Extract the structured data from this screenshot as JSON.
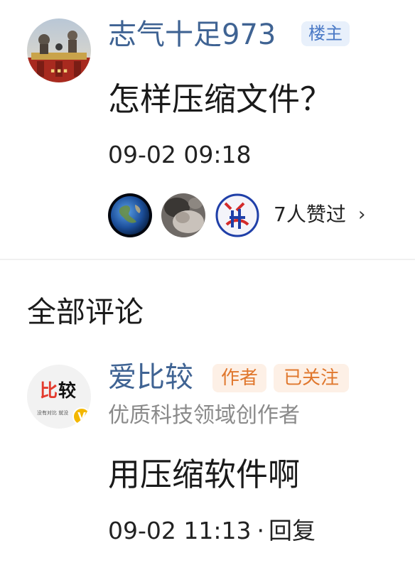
{
  "post": {
    "author": "志气十足973",
    "op_badge": "楼主",
    "question": "怎样压缩文件？",
    "time": "09-02 09:18",
    "likes_text": "7人赞过",
    "likes_chevron_icon": "chevron-right-icon"
  },
  "comments_section": {
    "title": "全部评论",
    "comments": [
      {
        "author": "爱比较",
        "author_badge": "作者",
        "follow_badge": "已关注",
        "author_subtitle": "优质科技领域创作者",
        "avatar_logo": {
          "line1_red": "比",
          "line1_black": "较",
          "tagline": "没有对比 就没",
          "verified": "V"
        },
        "text": "用压缩软件啊",
        "time": "09-02 11:13",
        "separator": "·",
        "reply_label": "回复"
      }
    ]
  },
  "colors": {
    "name_blue": "#3f6393",
    "op_badge_bg": "#e8f0fb",
    "op_badge_text": "#4a79c6",
    "author_badge_bg": "#fdf0e6",
    "author_badge_text": "#e0772d",
    "subtitle_gray": "#8a8a8a"
  }
}
